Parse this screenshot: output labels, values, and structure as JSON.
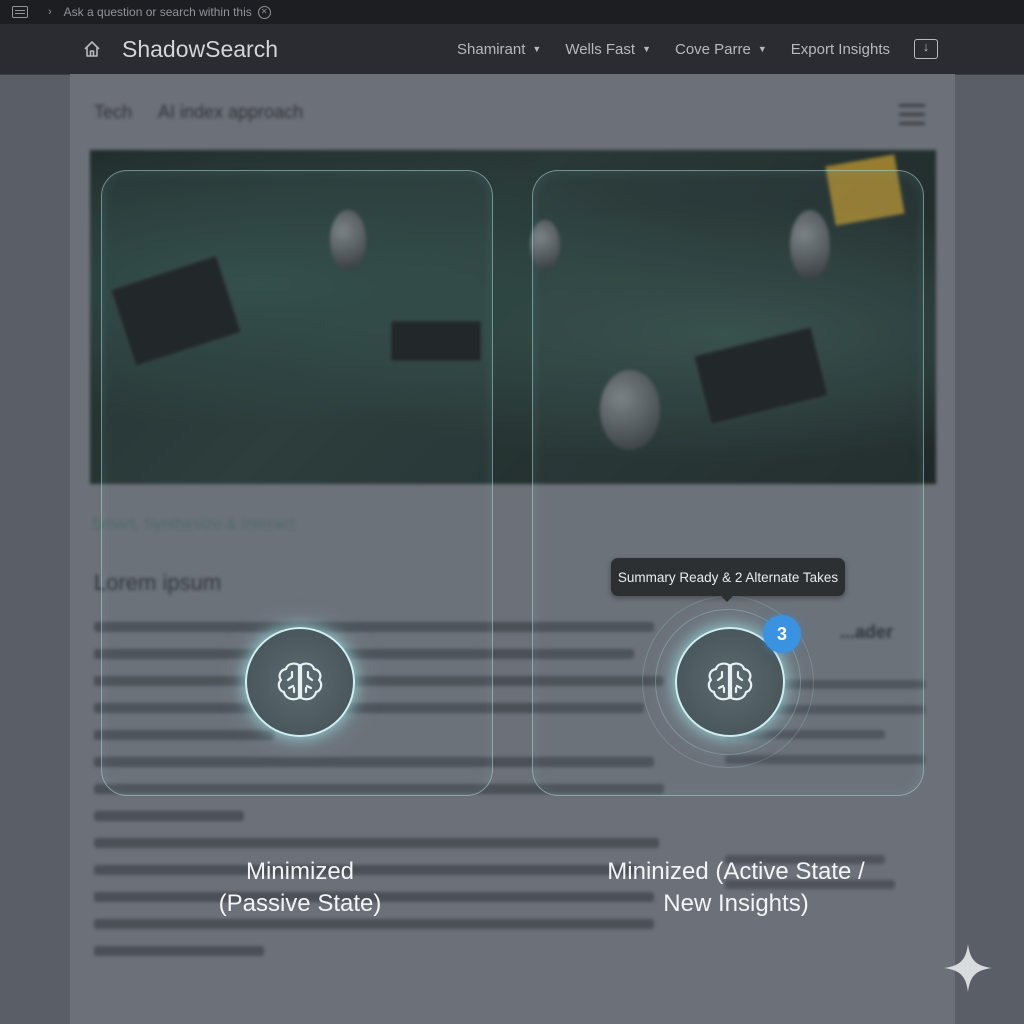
{
  "topbar": {
    "search_text": "Ask a question or search within this"
  },
  "navbar": {
    "brand": "ShadowSearch",
    "menu": [
      "Shamirant",
      "Wells Fast",
      "Cove Parre"
    ],
    "export_label": "Export Insights"
  },
  "page": {
    "breadcrumbs": [
      "Tech",
      "AI index approach"
    ],
    "tagline": "Smart, Synthesize & Interact",
    "article_title": "Lorem ipsum",
    "side_title": "...ader"
  },
  "cards": {
    "tooltip": "Summary Ready & 2 Alternate Takes",
    "badge_count": "3",
    "captions": [
      {
        "line1": "Minimized",
        "line2": "(Passive State)"
      },
      {
        "line1": "Mininized (Active State /",
        "line2": "New Insights)"
      }
    ]
  },
  "colors": {
    "accent": "#3a92e0",
    "glow": "#cfeff0",
    "navbar": "#2a2c31"
  }
}
